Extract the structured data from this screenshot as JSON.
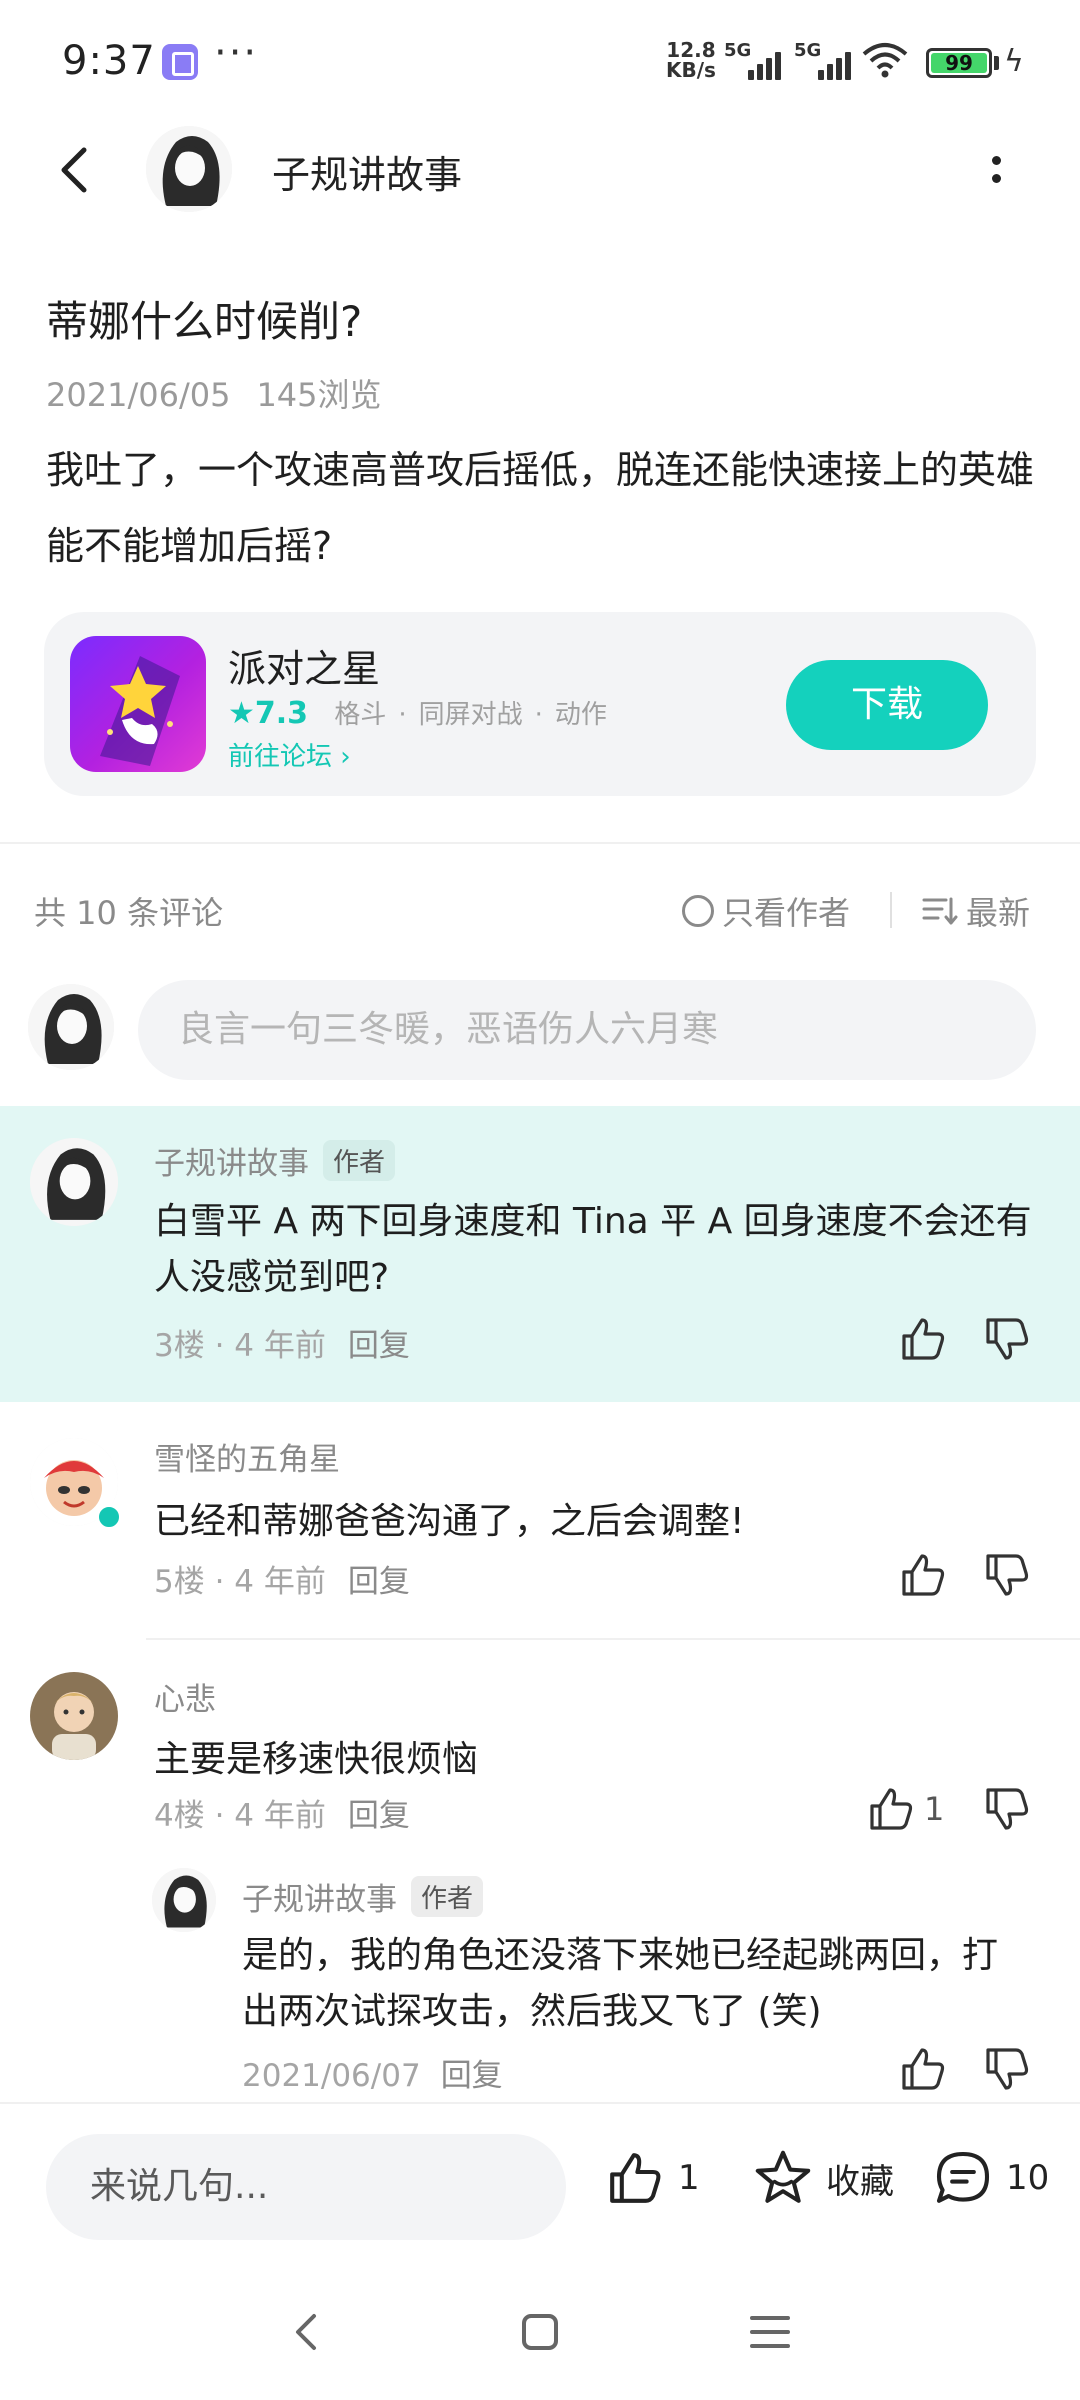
{
  "status_bar": {
    "time": "9:37",
    "dots": "···",
    "speed_value": "12.8",
    "speed_unit": "KB/s",
    "signal_label": "5G",
    "battery": "99",
    "icons": [
      "app-notification-icon",
      "signal-icon",
      "wifi-icon",
      "battery-icon",
      "charging-icon"
    ]
  },
  "header": {
    "title": "子规讲故事",
    "icons": [
      "back-arrow-icon",
      "more-vertical-icon"
    ]
  },
  "post": {
    "title": "蒂娜什么时候削?",
    "date": "2021/06/05",
    "views": "145浏览",
    "body": "我吐了，一个攻速高普攻后摇低，脱连还能快速接上的英雄能不能增加后摇?"
  },
  "game_card": {
    "name": "派对之星",
    "rating": "★7.3",
    "tags": [
      "格斗",
      "同屏对战",
      "动作"
    ],
    "forum_link": "前往论坛 ›",
    "download_label": "下载"
  },
  "comments_bar": {
    "count": "共 10 条评论",
    "only_author": "只看作者",
    "sort": "最新"
  },
  "comment_input": {
    "placeholder": "良言一句三冬暖，恶语伤人六月寒"
  },
  "comments": [
    {
      "name": "子规讲故事",
      "badge": "作者",
      "text": "白雪平 A 两下回身速度和 Tina 平 A 回身速度不会还有人没感觉到吧?",
      "floor": "3楼 · 4 年前",
      "reply": "回复",
      "likes": ""
    },
    {
      "name": "雪怪的五角星",
      "badge": "",
      "text": "已经和蒂娜爸爸沟通了，之后会调整!",
      "floor": "5楼 · 4 年前",
      "reply": "回复",
      "likes": ""
    },
    {
      "name": "心悲",
      "badge": "",
      "text": "主要是移速快很烦恼",
      "floor": "4楼 · 4 年前",
      "reply": "回复",
      "likes": "1",
      "sub_reply": {
        "name": "子规讲故事",
        "badge": "作者",
        "text": "是的，我的角色还没落下来她已经起跳两回，打出两次试探攻击，然后我又飞了 (笑)",
        "date": "2021/06/07",
        "reply": "回复"
      }
    }
  ],
  "bottom_bar": {
    "input_placeholder": "来说几句...",
    "likes": "1",
    "favorite_label": "收藏",
    "comments": "10"
  },
  "colors": {
    "accent": "#14c7b4",
    "highlight_bg": "#e2f7f4",
    "input_bg": "#f3f4f6"
  }
}
